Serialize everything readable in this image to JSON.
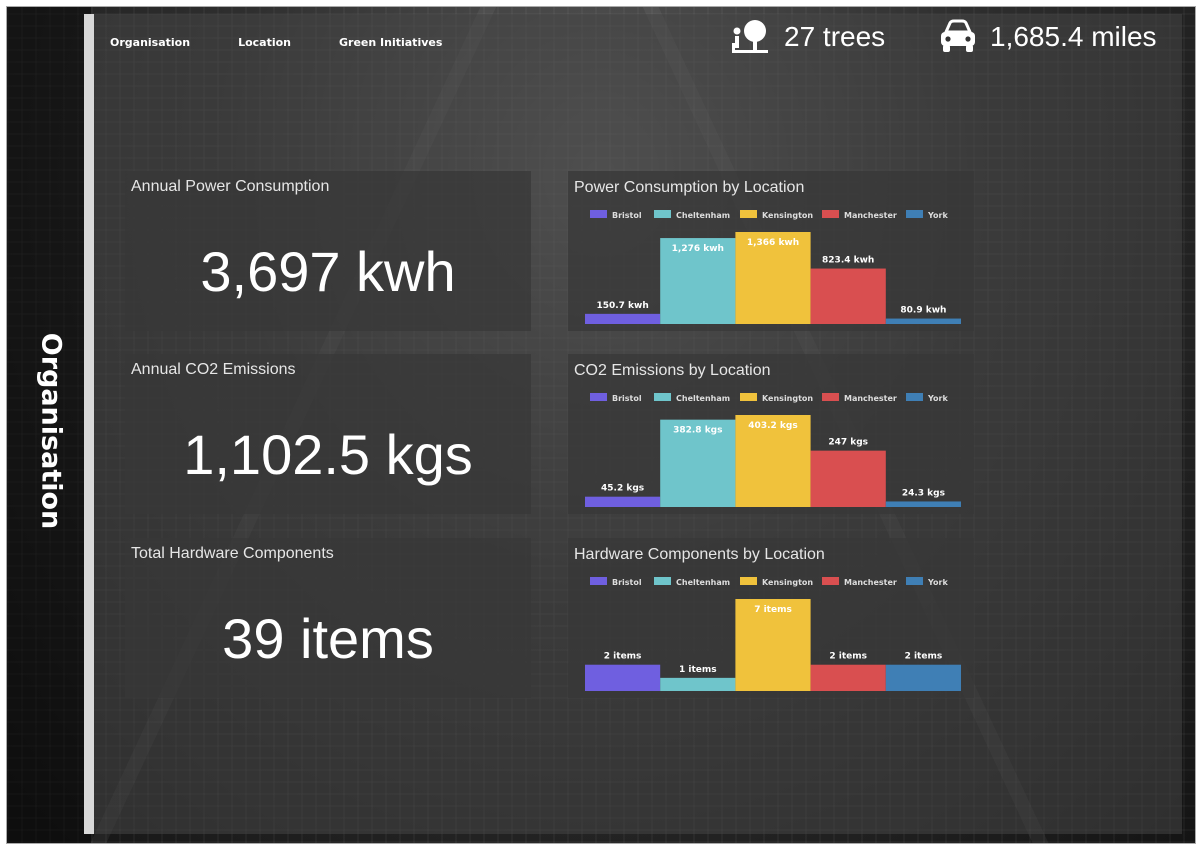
{
  "nav": {
    "items": [
      "Organisation",
      "Location",
      "Green Initiatives"
    ]
  },
  "header": {
    "trees": "27 trees",
    "miles": "1,685.4 miles",
    "tree_icon": "tree-person-icon",
    "car_icon": "car-icon"
  },
  "sidebar": {
    "title": "Organisation"
  },
  "kpis": [
    {
      "title": "Annual Power Consumption",
      "value": "3,697 kwh"
    },
    {
      "title": "Annual CO2 Emissions",
      "value": "1,102.5 kgs"
    },
    {
      "title": "Total Hardware Components",
      "value": "39 items"
    }
  ],
  "colors": {
    "Bristol": "#6f5fe0",
    "Cheltenham": "#6fc5cb",
    "Kensington": "#f0c23c",
    "Manchester": "#d94f50",
    "York": "#3f7fb5"
  },
  "chart_data": [
    {
      "type": "bar",
      "title": "Power Consumption by Location",
      "categories": [
        "Bristol",
        "Cheltenham",
        "Kensington",
        "Manchester",
        "York"
      ],
      "values": [
        150.7,
        1276,
        1366,
        823.4,
        80.9
      ],
      "labels": [
        "150.7 kwh",
        "1,276 kwh",
        "1,366 kwh",
        "823.4 kwh",
        "80.9 kwh"
      ],
      "legend": "top"
    },
    {
      "type": "bar",
      "title": "CO2 Emissions by Location",
      "categories": [
        "Bristol",
        "Cheltenham",
        "Kensington",
        "Manchester",
        "York"
      ],
      "values": [
        45.2,
        382.8,
        403.2,
        247,
        24.3
      ],
      "labels": [
        "45.2 kgs",
        "382.8 kgs",
        "403.2 kgs",
        "247 kgs",
        "24.3 kgs"
      ],
      "legend": "top"
    },
    {
      "type": "bar",
      "title": "Hardware Components by Location",
      "categories": [
        "Bristol",
        "Cheltenham",
        "Kensington",
        "Manchester",
        "York"
      ],
      "values": [
        2,
        1,
        7,
        2,
        2
      ],
      "labels": [
        "2 items",
        "1 items",
        "7 items",
        "2 items",
        "2 items"
      ],
      "legend": "top"
    }
  ]
}
